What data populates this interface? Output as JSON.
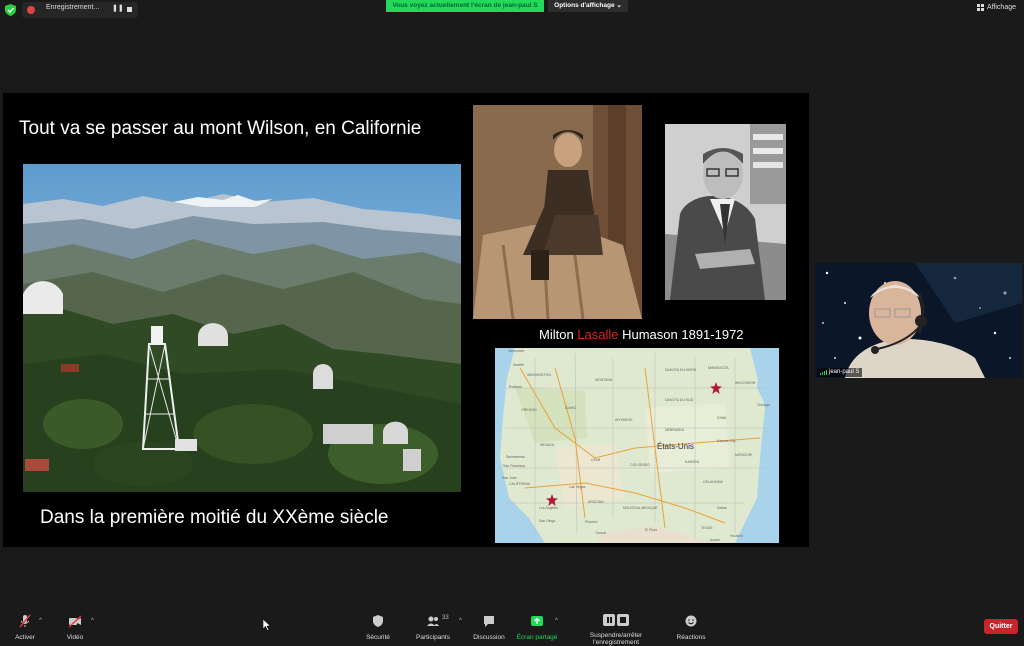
{
  "recording": {
    "label": "Enregistrement...",
    "pause_glyph": "❚❚"
  },
  "share_banner": "Vous voyez actuellement l'écran de jean-paul S",
  "view_options": "Options d'affichage ⌄",
  "view_button": "Affichage",
  "slide": {
    "title": "Tout va se passer au mont Wilson, en Californie",
    "caption_pre": "Milton ",
    "caption_red": "Lasalle",
    "caption_post": " Humason 1891-1972",
    "subtitle": "Dans la première moitié du XXème siècle",
    "map": {
      "country": "États-Unis",
      "labels": [
        "Vancouver",
        "Seattle",
        "WASHINGTON",
        "Portland",
        "OREGON",
        "IDAHO",
        "MONTANA",
        "WYOMING",
        "NEVADA",
        "UTAH",
        "COLORADO",
        "CALIFORNIA",
        "San Francisco",
        "Sacramento",
        "San José",
        "Las Vegas",
        "Los Angeles",
        "San Diego",
        "ARIZONA",
        "Phoenix",
        "Tucson",
        "NOUVEAU-MEXIQUE",
        "El Paso",
        "TEXAS",
        "Dallas",
        "Houston",
        "OKLAHOMA",
        "KANSAS",
        "Kansas City",
        "NEBRASKA",
        "DAKOTA DU SUD",
        "DAKOTA DU NORD",
        "MINNESOTA",
        "WISCONSIN",
        "IOWA",
        "Chicago",
        "MISSOURI",
        "Austin"
      ]
    }
  },
  "webcam": {
    "name": "jean-paul S"
  },
  "toolbar": {
    "audio": "Activer",
    "video": "Vidéo",
    "security": "Sécurité",
    "participants": "Participants",
    "participants_count": "33",
    "chat": "Discussion",
    "share": "Écran partagé",
    "record": "Suspendre/arrêter l'enregistrement",
    "reactions": "Réactions",
    "quit": "Quitter"
  },
  "colors": {
    "share_green": "#23d959",
    "quit_red": "#c8252a",
    "caption_red": "#e02020"
  }
}
